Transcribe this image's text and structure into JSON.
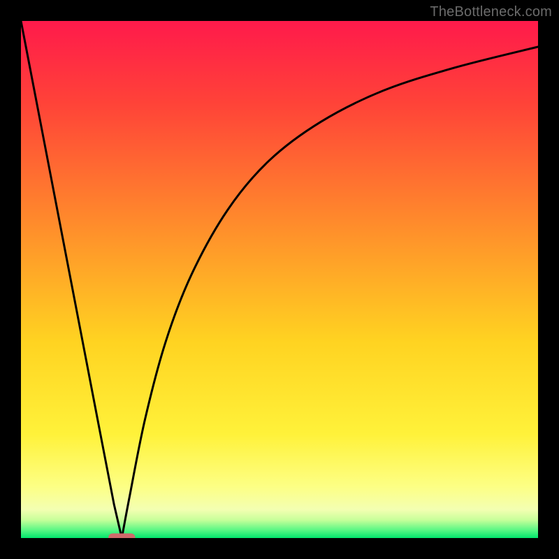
{
  "watermark": "TheBottleneck.com",
  "chart_data": {
    "type": "line",
    "title": "",
    "xlabel": "",
    "ylabel": "",
    "xlim": [
      0,
      100
    ],
    "ylim": [
      0,
      100
    ],
    "grid": false,
    "series": [
      {
        "name": "left-branch",
        "x": [
          0,
          5,
          10,
          15,
          18,
          19.5
        ],
        "y": [
          100,
          74,
          48,
          22,
          6.5,
          0
        ]
      },
      {
        "name": "right-branch",
        "x": [
          19.5,
          21,
          24,
          28,
          33,
          40,
          48,
          58,
          70,
          84,
          100
        ],
        "y": [
          0,
          8,
          23,
          38,
          51,
          63.5,
          73,
          80.5,
          86.5,
          91,
          95
        ]
      }
    ],
    "marker": {
      "name": "bottleneck-marker",
      "x": 19.5,
      "y": 0,
      "half_width": 2.6,
      "half_height": 0.9,
      "color": "#cf6a6b"
    },
    "gradient_stops": [
      {
        "offset": 0.0,
        "color": "#ff1a4b"
      },
      {
        "offset": 0.16,
        "color": "#ff4338"
      },
      {
        "offset": 0.4,
        "color": "#ff8e2b"
      },
      {
        "offset": 0.62,
        "color": "#ffd321"
      },
      {
        "offset": 0.8,
        "color": "#fff23a"
      },
      {
        "offset": 0.9,
        "color": "#fdff84"
      },
      {
        "offset": 0.945,
        "color": "#f3ffb2"
      },
      {
        "offset": 0.965,
        "color": "#c7ff9a"
      },
      {
        "offset": 0.985,
        "color": "#57f784"
      },
      {
        "offset": 1.0,
        "color": "#00e56c"
      }
    ],
    "curve_color": "#000000",
    "curve_width": 3
  }
}
